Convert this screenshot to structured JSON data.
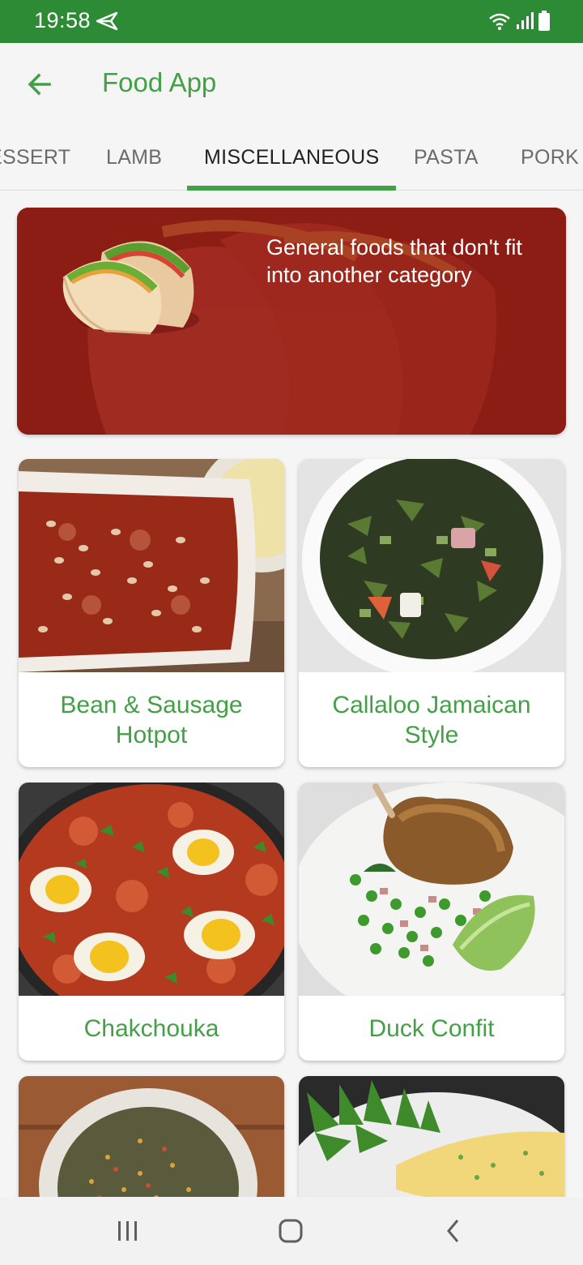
{
  "status_bar": {
    "time": "19:58",
    "icons": [
      "send-icon",
      "wifi-icon",
      "signal-icon",
      "battery-icon"
    ]
  },
  "app_bar": {
    "title": "Food App",
    "back_icon": "arrow-back-icon"
  },
  "tabs": [
    {
      "label": "ESSERT",
      "active": false
    },
    {
      "label": "LAMB",
      "active": false
    },
    {
      "label": "MISCELLANEOUS",
      "active": true
    },
    {
      "label": "PASTA",
      "active": false
    },
    {
      "label": "PORK",
      "active": false
    }
  ],
  "banner": {
    "description": "General foods that don't fit into another category"
  },
  "meals": [
    {
      "name": "Bean & Sausage Hotpot"
    },
    {
      "name": "Callaloo Jamaican Style"
    },
    {
      "name": "Chakchouka"
    },
    {
      "name": "Duck Confit"
    },
    {
      "name": ""
    },
    {
      "name": ""
    }
  ],
  "colors": {
    "primary": "#2e8b35",
    "accent": "#43a047",
    "banner": "#8b1d14"
  },
  "nav_bar": {
    "icons": [
      "recent-apps-icon",
      "home-icon",
      "back-icon"
    ]
  }
}
